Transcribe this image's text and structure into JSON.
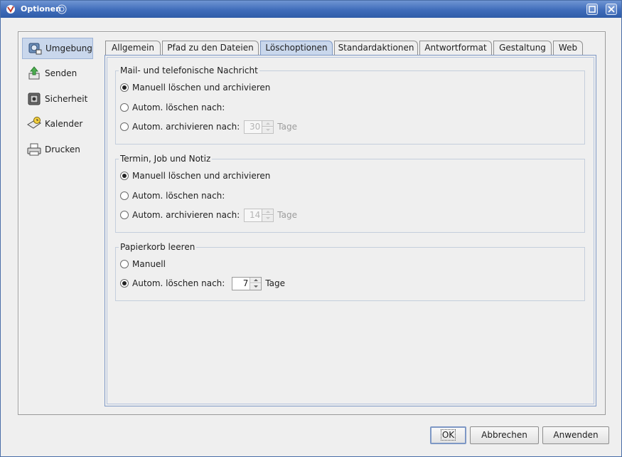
{
  "window": {
    "title": "Optionen"
  },
  "sidebar": {
    "items": [
      {
        "label": "Umgebung",
        "icon": "environment-icon",
        "active": true
      },
      {
        "label": "Senden",
        "icon": "send-icon",
        "active": false
      },
      {
        "label": "Sicherheit",
        "icon": "security-icon",
        "active": false
      },
      {
        "label": "Kalender",
        "icon": "calendar-icon",
        "active": false
      },
      {
        "label": "Drucken",
        "icon": "printer-icon",
        "active": false
      }
    ]
  },
  "tabs": [
    {
      "label": "Allgemein",
      "active": false
    },
    {
      "label": "Pfad zu den Dateien",
      "active": false
    },
    {
      "label": "Löschoptionen",
      "active": true
    },
    {
      "label": "Standardaktionen",
      "active": false
    },
    {
      "label": "Antwortformat",
      "active": false
    },
    {
      "label": "Gestaltung",
      "active": false
    },
    {
      "label": "Web",
      "active": false
    }
  ],
  "groups": {
    "mail": {
      "title": "Mail- und telefonische Nachricht",
      "opt_manual": "Manuell löschen und archivieren",
      "opt_auto_delete": "Autom. löschen nach:",
      "opt_auto_archive": "Autom. archivieren nach:",
      "days_value": "30",
      "unit": "Tage"
    },
    "termin": {
      "title": "Termin, Job und Notiz",
      "opt_manual": "Manuell löschen und archivieren",
      "opt_auto_delete": "Autom. löschen nach:",
      "opt_auto_archive": "Autom. archivieren nach:",
      "days_value": "14",
      "unit": "Tage"
    },
    "trash": {
      "title": "Papierkorb leeren",
      "opt_manual": "Manuell",
      "opt_auto_delete": "Autom. löschen nach:",
      "days_value": "7",
      "unit": "Tage"
    }
  },
  "buttons": {
    "ok": "OK",
    "cancel": "Abbrechen",
    "apply": "Anwenden"
  },
  "colors": {
    "titlebar": "#3f6cba",
    "selection": "#c9d7ec",
    "accent_border": "#7e98c5"
  }
}
